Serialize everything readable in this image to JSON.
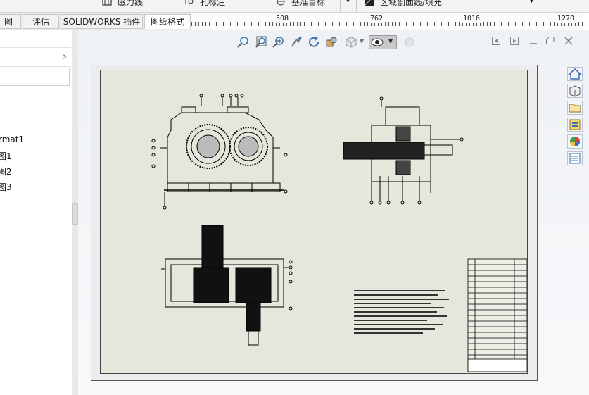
{
  "toolbar": {
    "items": [
      "磁力线",
      "孔标注",
      "基准目标",
      "区域剖面线/填充"
    ]
  },
  "tabs": [
    {
      "label": "图"
    },
    {
      "label": "评估"
    },
    {
      "label": "SOLIDWORKS 插件"
    },
    {
      "label": "图纸格式",
      "active": true
    }
  ],
  "ruler": {
    "ticks": [
      "508",
      "762",
      "1016",
      "1270"
    ]
  },
  "tree": {
    "items": [
      "rmat1",
      "图1",
      "图2",
      "图3"
    ]
  },
  "colors": {
    "canvas_bg": "#eef1f5",
    "sheet_bg": "#e6e6dc",
    "accent": "#3a6fb0"
  },
  "icons": {
    "heads_up": [
      "zoom-to-fit-icon",
      "zoom-to-area-icon",
      "zoom-in-out-icon",
      "pan-icon",
      "rotate-icon",
      "display-style-icon",
      "view-orientation-icon",
      "hide-show-icon",
      "appearance-icon"
    ],
    "window": [
      "restore-left-icon",
      "restore-right-icon",
      "minimize-icon",
      "maximize-icon",
      "close-icon"
    ],
    "taskpane": [
      "home-icon",
      "3d-content-icon",
      "file-explorer-icon",
      "view-palette-icon",
      "appearances-icon",
      "custom-properties-icon"
    ]
  }
}
